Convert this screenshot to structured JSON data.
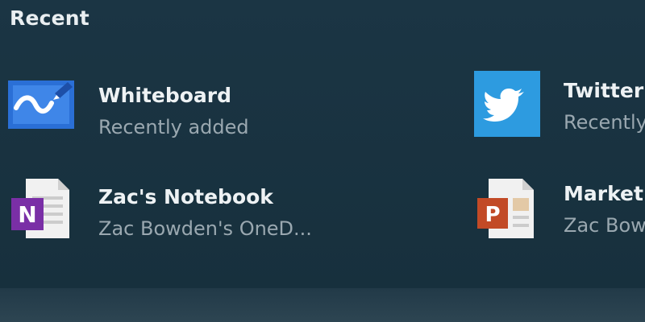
{
  "section": {
    "title": "Recent"
  },
  "items": [
    {
      "title": "Whiteboard",
      "subtitle": "Recently added",
      "icon": "whiteboard-icon",
      "icon_color": "#2a6fd6"
    },
    {
      "title": "Twitter",
      "subtitle": "Recently added",
      "icon": "twitter-bird-icon",
      "icon_color": "#2d9be0"
    },
    {
      "title": "Zac's Notebook",
      "subtitle": "Zac Bowden's OneD...",
      "icon": "onenote-notebook-icon",
      "icon_color": "#7a2fa6"
    },
    {
      "title": "Marketing",
      "subtitle": "Zac Bowden's OneD...",
      "icon": "powerpoint-file-icon",
      "icon_color": "#c24a26"
    }
  ]
}
